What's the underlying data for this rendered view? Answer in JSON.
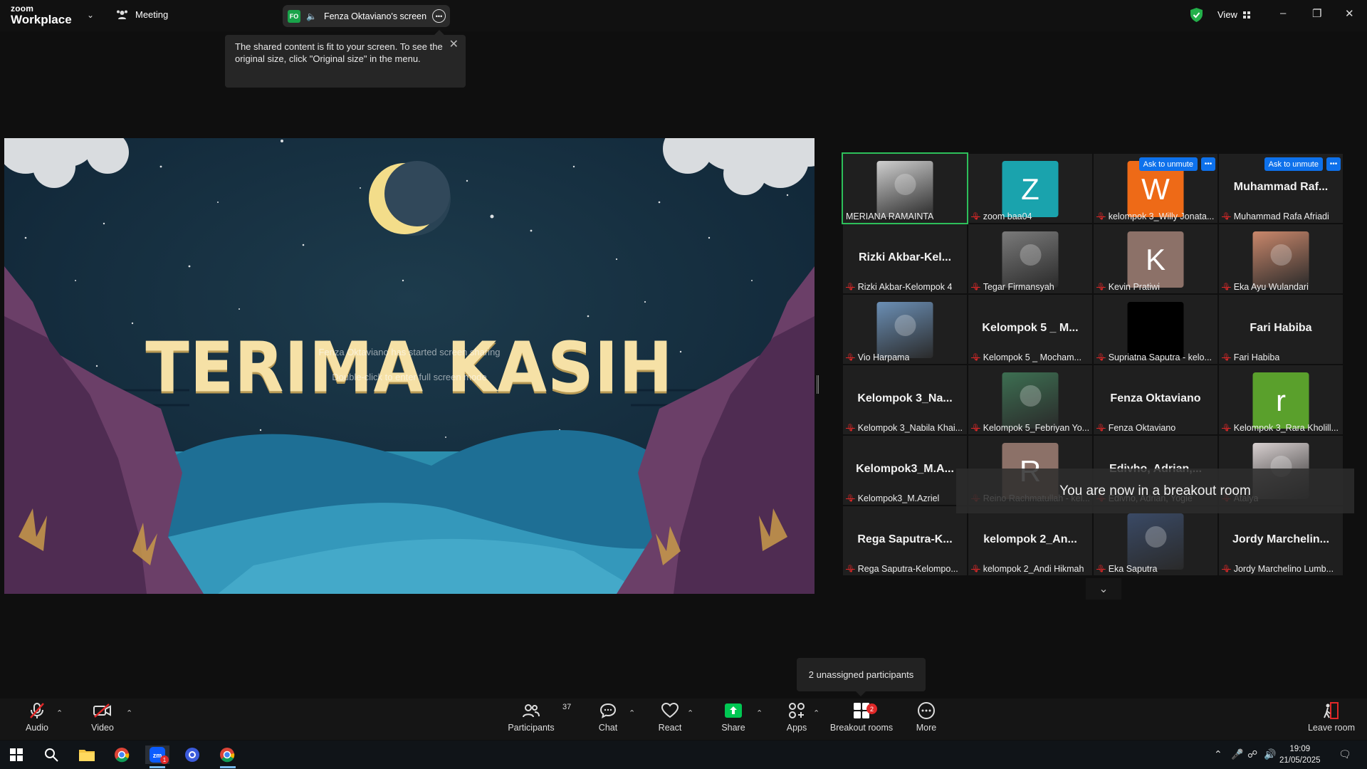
{
  "topbar": {
    "brand_top": "zoom",
    "brand_bottom": "Workplace",
    "meeting_label": "Meeting",
    "share_badge": "FO",
    "share_title": "Fenza Oktaviano's screen",
    "view_label": "View"
  },
  "tooltip": {
    "text": "The shared content is fit to your screen. To see the original size, click \"Original size\" in the menu."
  },
  "shared_screen": {
    "slide_title": "TERIMA KASIH",
    "overlay_line1": "Fenza Oktaviano has started screen sharing",
    "overlay_line2": "Double-click to enter full screen mode"
  },
  "gallery": {
    "ask_to_unmute": "Ask to unmute",
    "breakout_banner": "You are now in a breakout room",
    "tiles": [
      {
        "caption": "MERIANA RAMAINTA",
        "big": "",
        "avatar": "photo",
        "color": "#cfcfcf",
        "muted": false,
        "active": true
      },
      {
        "caption": "zoom baa04",
        "big": "",
        "avatar": "Z",
        "color": "#1aa3ad",
        "muted": true
      },
      {
        "caption": "kelompok 3_Willy Jonata...",
        "big": "",
        "avatar": "W",
        "color": "#ee6a17",
        "muted": true,
        "ask": true
      },
      {
        "caption": "Muhammad Rafa Afriadi",
        "big": "Muhammad  Raf...",
        "avatar": "",
        "muted": true,
        "ask": true
      },
      {
        "caption": "Rizki Akbar-Kelompok 4",
        "big": "Rizki  Akbar-Kel...",
        "avatar": "",
        "muted": true
      },
      {
        "caption": "Tegar Firmansyah",
        "big": "",
        "avatar": "photo",
        "color": "#7a7a7a",
        "muted": true
      },
      {
        "caption": "Kevin Pratiwi",
        "big": "",
        "avatar": "K",
        "color": "#8c7168",
        "muted": true
      },
      {
        "caption": "Eka Ayu Wulandari",
        "big": "",
        "avatar": "photo",
        "color": "#c9876b",
        "muted": true
      },
      {
        "caption": "Vio Harpama",
        "big": "",
        "avatar": "photo",
        "color": "#6b8fb5",
        "muted": true
      },
      {
        "caption": "Kelompok 5 _ Mocham...",
        "big": "Kelompok 5  _  M...",
        "avatar": "",
        "muted": true
      },
      {
        "caption": "Supriatna Saputra - kelo...",
        "big": "",
        "avatar": "black",
        "color": "#000000",
        "muted": true
      },
      {
        "caption": "Fari Habiba",
        "big": "Fari Habiba",
        "avatar": "",
        "muted": true
      },
      {
        "caption": "Kelompok 3_Nabila Khai...",
        "big": "Kelompok  3_Na...",
        "avatar": "",
        "muted": true
      },
      {
        "caption": "Kelompok 5_Febriyan Yo...",
        "big": "",
        "avatar": "photo",
        "color": "#3d6f52",
        "muted": true
      },
      {
        "caption": "Fenza Oktaviano",
        "big": "Fenza Oktaviano",
        "avatar": "",
        "muted": true
      },
      {
        "caption": "Kelompok 3_Rara Kholill...",
        "big": "",
        "avatar": "r",
        "color": "#5aa02c",
        "muted": true
      },
      {
        "caption": "Kelompok3_M.Azriel",
        "big": "Kelompok3_M.A...",
        "avatar": "",
        "muted": true
      },
      {
        "caption": "Reino Rachmatullah - kel...",
        "big": "",
        "avatar": "R",
        "color": "#8c7168",
        "muted": true
      },
      {
        "caption": "Edivho, Adrian, Yogie",
        "big": "Edivho,   Adrian,...",
        "avatar": "",
        "muted": true
      },
      {
        "caption": "Atalya",
        "big": "",
        "avatar": "photo",
        "color": "#d8d0d0",
        "muted": true
      },
      {
        "caption": "Rega Saputra-Kelompo...",
        "big": "Rega  Saputra-K...",
        "avatar": "",
        "muted": true
      },
      {
        "caption": "kelompok 2_Andi Hikmah",
        "big": "kelompok  2_An...",
        "avatar": "",
        "muted": true
      },
      {
        "caption": "Eka Saputra",
        "big": "",
        "avatar": "photo",
        "color": "#3a4a66",
        "muted": true
      },
      {
        "caption": "Jordy Marchelino Lumb...",
        "big": "Jordy  Marchelin...",
        "avatar": "",
        "muted": true
      }
    ]
  },
  "unassigned_tooltip": "2 unassigned participants",
  "toolbar": {
    "audio": "Audio",
    "video": "Video",
    "participants": "Participants",
    "participants_count": "37",
    "chat": "Chat",
    "react": "React",
    "share": "Share",
    "apps": "Apps",
    "breakout_rooms": "Breakout rooms",
    "breakout_badge": "2",
    "more": "More",
    "leave_room": "Leave room"
  },
  "taskbar": {
    "time": "19:09",
    "date": "21/05/2025",
    "zoom_badge": "1"
  },
  "colors": {
    "accent_blue": "#0e71eb",
    "share_green": "#00c853",
    "mute_red": "#e02828",
    "active_border": "#2dbf5a"
  }
}
